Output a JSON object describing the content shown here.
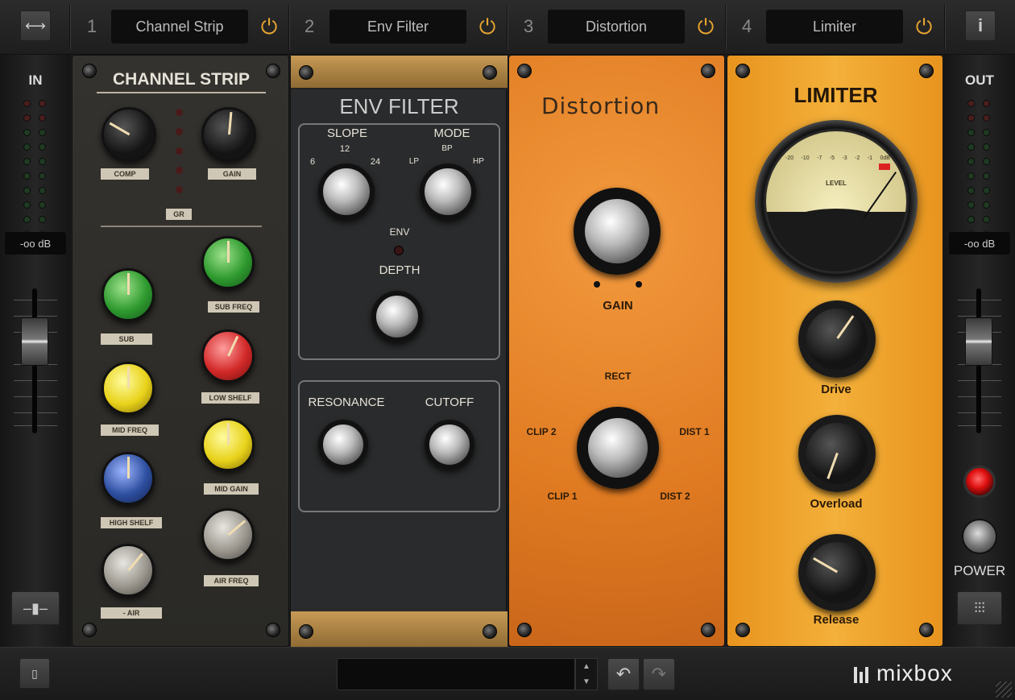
{
  "header": {
    "slots": [
      {
        "num": "1",
        "name": "Channel Strip"
      },
      {
        "num": "2",
        "name": "Env Filter"
      },
      {
        "num": "3",
        "name": "Distortion"
      },
      {
        "num": "4",
        "name": "Limiter"
      }
    ],
    "info_label": "i"
  },
  "input": {
    "label": "IN",
    "db": "-oo dB"
  },
  "output": {
    "label": "OUT",
    "db": "-oo dB",
    "power_label": "POWER"
  },
  "channel_strip": {
    "title": "CHANNEL STRIP",
    "comp": "COMP",
    "gain": "GAIN",
    "gr": "GR",
    "sub": "SUB",
    "sub_freq": "SUB FREQ",
    "low_shelf": "LOW SHELF",
    "mid_freq": "MID FREQ",
    "mid_gain": "MID GAIN",
    "high_shelf": "HIGH SHELF",
    "air_freq": "AIR FREQ",
    "air": "- AIR"
  },
  "env_filter": {
    "title": "ENV FILTER",
    "slope": "SLOPE",
    "slope_6": "6",
    "slope_12": "12",
    "slope_24": "24",
    "mode": "MODE",
    "mode_lp": "LP",
    "mode_bp": "BP",
    "mode_hp": "HP",
    "env": "ENV",
    "depth": "DEPTH",
    "resonance": "RESONANCE",
    "cutoff": "CUTOFF"
  },
  "distortion": {
    "title": "Distortion",
    "gain": "GAIN",
    "rect": "RECT",
    "clip2": "CLIP 2",
    "dist1": "DIST 1",
    "clip1": "CLIP 1",
    "dist2": "DIST 2"
  },
  "limiter": {
    "title": "LIMITER",
    "meter_label": "LEVEL",
    "scale": [
      "-20",
      "-10",
      "-7",
      "-5",
      "-3",
      "-2",
      "-1",
      "0dB"
    ],
    "drive": "Drive",
    "overload": "Overload",
    "release": "Release"
  },
  "footer": {
    "brand": "mixbox"
  },
  "colors": {
    "accent": "#e8a530",
    "orange": "#e8862a",
    "limiter": "#eea22a",
    "panel_dark": "#2a2926"
  }
}
